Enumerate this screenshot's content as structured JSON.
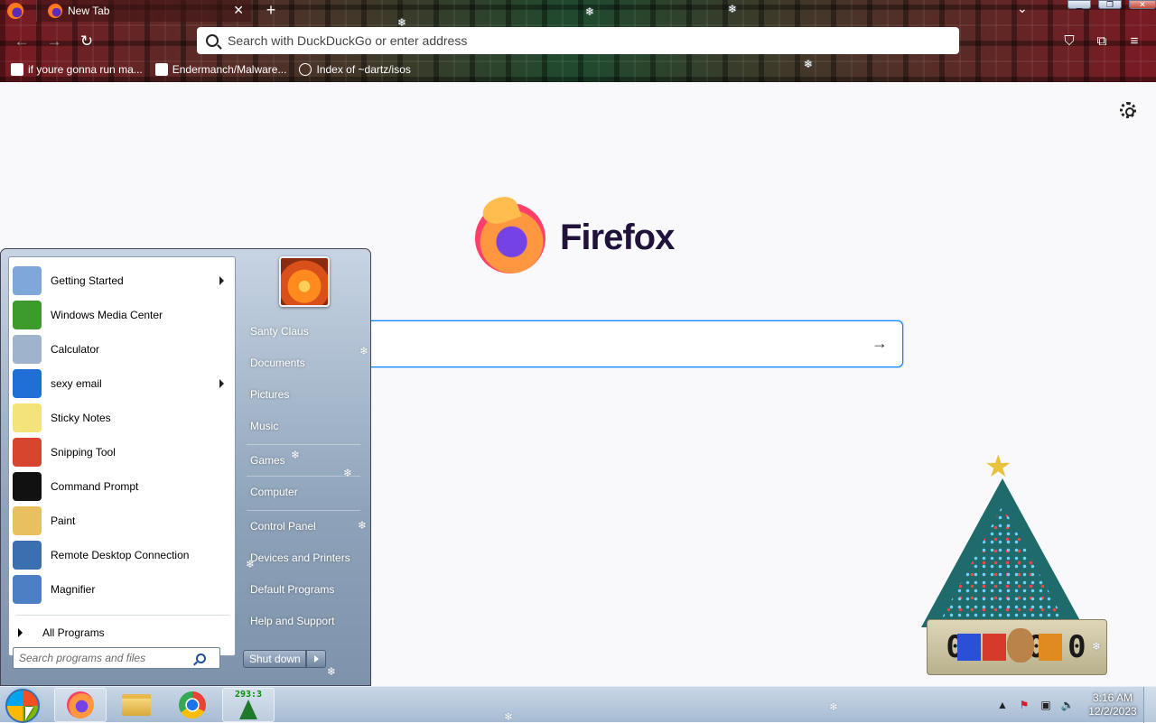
{
  "browser": {
    "tab": {
      "title": "New Tab",
      "close_glyph": "✕"
    },
    "new_tab_glyph": "+",
    "tab_list_glyph": "⌄",
    "window_buttons": {
      "minimize": "▁",
      "maximize": "❐",
      "close": "✕"
    },
    "nav": {
      "back": "←",
      "forward": "→",
      "reload": "↻"
    },
    "address_placeholder": "Search with DuckDuckGo or enter address",
    "toolbar_icons": {
      "pocket": "⛉",
      "extensions": "⧉",
      "menu": "≡"
    },
    "bookmarks": [
      {
        "label": "if youre gonna run ma...",
        "icon": "doc-icon"
      },
      {
        "label": "Endermanch/Malware...",
        "icon": "page-icon"
      },
      {
        "label": "Index of ~dartz/isos",
        "icon": "globe-icon"
      }
    ]
  },
  "newtab": {
    "wordmark": "Firefox",
    "search_arrow": "→"
  },
  "gadget": {
    "counter": "0 0:0 0"
  },
  "startmenu": {
    "programs": [
      {
        "label": "Getting Started",
        "has_submenu": true,
        "icon": "getting-started-icon",
        "color": "#7fa8d8"
      },
      {
        "label": "Windows Media Center",
        "has_submenu": false,
        "icon": "media-center-icon",
        "color": "#3d9b2e"
      },
      {
        "label": "Calculator",
        "has_submenu": false,
        "icon": "calculator-icon",
        "color": "#9fb4cc"
      },
      {
        "label": "sexy email",
        "has_submenu": true,
        "icon": "thunderbird-icon",
        "color": "#1f6fd6"
      },
      {
        "label": "Sticky Notes",
        "has_submenu": false,
        "icon": "sticky-notes-icon",
        "color": "#f4e27a"
      },
      {
        "label": "Snipping Tool",
        "has_submenu": false,
        "icon": "snipping-tool-icon",
        "color": "#d7452f"
      },
      {
        "label": "Command Prompt",
        "has_submenu": false,
        "icon": "command-prompt-icon",
        "color": "#111111"
      },
      {
        "label": "Paint",
        "has_submenu": false,
        "icon": "paint-icon",
        "color": "#e8c060"
      },
      {
        "label": "Remote Desktop Connection",
        "has_submenu": false,
        "icon": "remote-desktop-icon",
        "color": "#3a6fb0"
      },
      {
        "label": "Magnifier",
        "has_submenu": false,
        "icon": "magnifier-icon",
        "color": "#4d7fc4"
      }
    ],
    "all_programs": "All Programs",
    "search_placeholder": "Search programs and files",
    "right_items": [
      "Santy Claus",
      "Documents",
      "Pictures",
      "Music",
      "Games",
      "Computer",
      "Control Panel",
      "Devices and Printers",
      "Default Programs",
      "Help and Support"
    ],
    "shutdown_label": "Shut down"
  },
  "taskbar": {
    "tree_counter": "293:3",
    "clock_time": "3:16 AM",
    "clock_date": "12/2/2023",
    "tray_icons": {
      "show_hidden": "▲",
      "action_center": "⚑",
      "network": "▣",
      "volume": "🔈"
    }
  }
}
